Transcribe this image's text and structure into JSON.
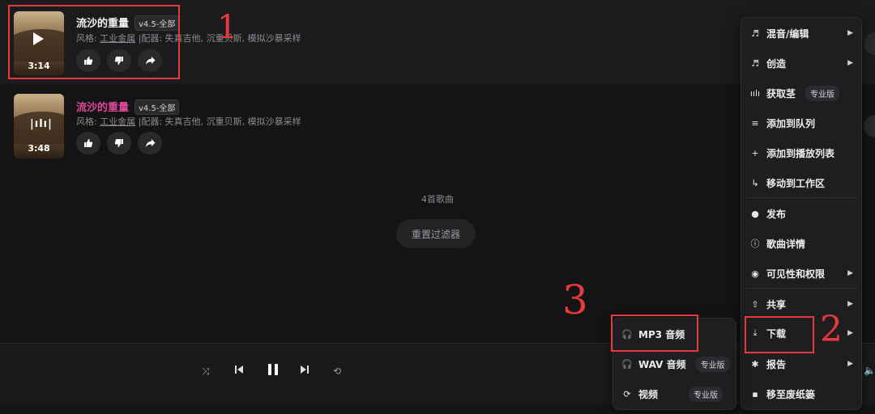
{
  "songs": [
    {
      "title": "流沙的重量",
      "version": "v4.5-全部",
      "style_prefix": "风格: ",
      "style_link": "工业金属",
      "style_rest": " |配器: 失真吉他, 沉重贝斯, 模拟沙暴采样",
      "duration": "3:14",
      "state": "paused"
    },
    {
      "title": "流沙的重量",
      "version": "v4.5-全部",
      "style_prefix": "风格: ",
      "style_link": "工业金属",
      "style_rest": " |配器: 失真吉他, 沉重贝斯, 模拟沙暴采样",
      "duration": "3:48",
      "state": "playing"
    }
  ],
  "song_count": "4首歌曲",
  "reset_filter": "重置过滤器",
  "context_menu": {
    "items": [
      {
        "label": "混音/编辑",
        "icon": "music-note-icon"
      },
      {
        "label": "创造",
        "icon": "music-note-icon"
      },
      {
        "label": "获取茎",
        "icon": "waveform-icon",
        "pro": "专业版"
      },
      {
        "label": "添加到队列",
        "icon": "queue-icon"
      },
      {
        "label": "添加到播放列表",
        "icon": "plus-icon"
      },
      {
        "label": "移动到工作区",
        "icon": "move-arrow-icon"
      },
      {
        "label": "发布",
        "icon": "globe-icon"
      },
      {
        "label": "歌曲详情",
        "icon": "info-icon"
      },
      {
        "label": "可见性和权限",
        "icon": "eye-icon"
      },
      {
        "label": "共享",
        "icon": "share-icon"
      },
      {
        "label": "下载",
        "icon": "download-icon"
      },
      {
        "label": "报告",
        "icon": "bug-icon"
      },
      {
        "label": "移至废纸篓",
        "icon": "trash-icon"
      }
    ]
  },
  "download_submenu": {
    "items": [
      {
        "label": "MP3 音频",
        "icon": "headphones-icon"
      },
      {
        "label": "WAV 音频",
        "icon": "headphones-icon",
        "pro": "专业版"
      },
      {
        "label": "视频",
        "icon": "video-icon",
        "pro": "专业版"
      }
    ]
  },
  "annotations": {
    "one": "1",
    "two": "2",
    "three": "3"
  },
  "colors": {
    "annotation": "#e53a3a",
    "accent_title": "#e0489a",
    "background": "#141416"
  }
}
